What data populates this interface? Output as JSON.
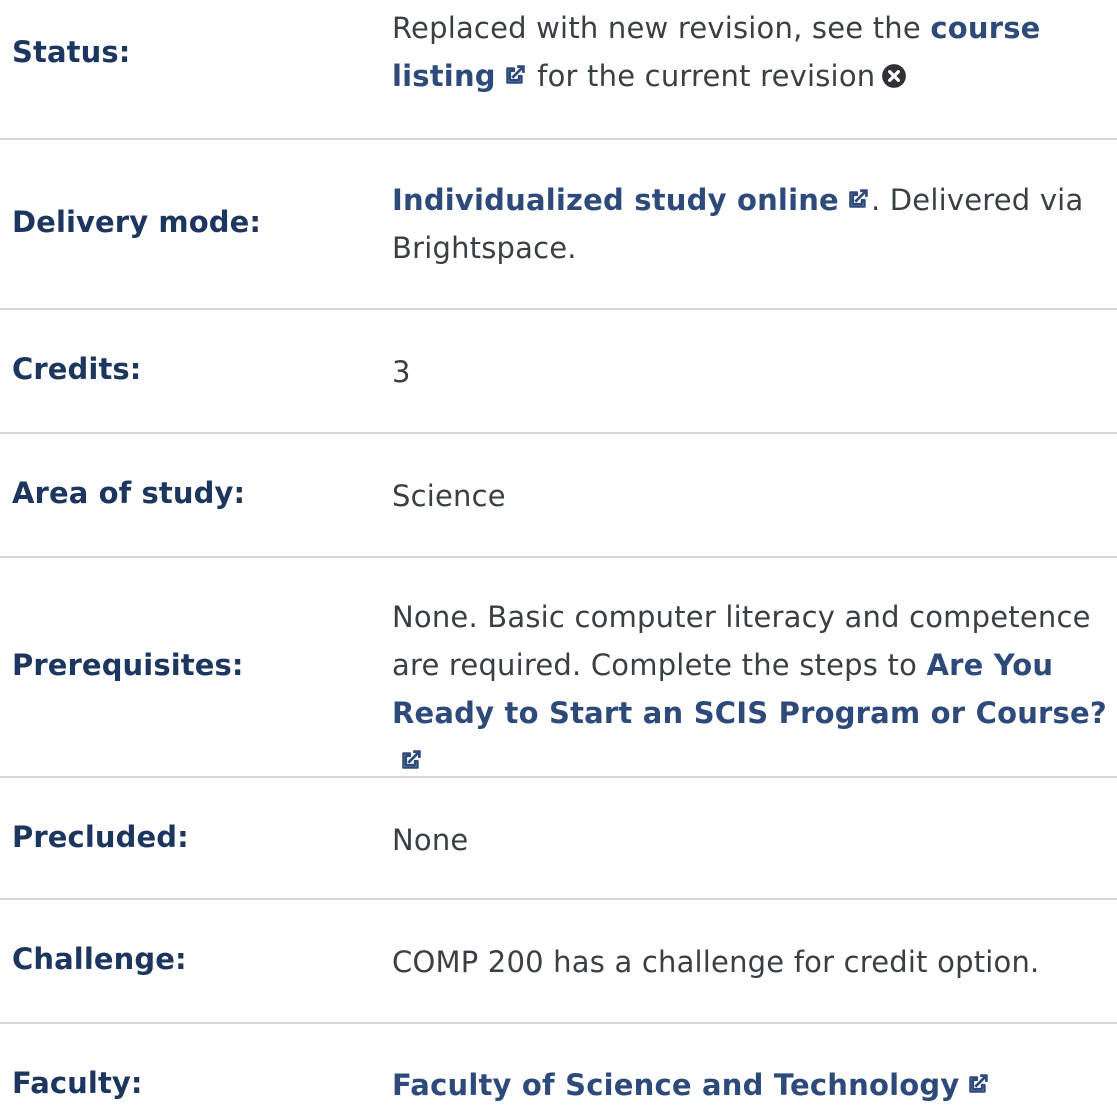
{
  "rows": [
    {
      "label": "Status:",
      "value_prefix": "Replaced with new revision, see the ",
      "link": "course listing",
      "value_suffix": " for the current revision",
      "icon": "times-circle-icon"
    },
    {
      "label": "Delivery mode:",
      "link": "Individualized study online",
      "value_suffix": ". Delivered via Brightspace."
    },
    {
      "label": "Credits:",
      "value": "3"
    },
    {
      "label": "Area of study:",
      "value": "Science"
    },
    {
      "label": "Prerequisites:",
      "value_prefix": "None. Basic computer literacy and competence are required. Complete the steps to ",
      "link": "Are You Ready to Start an SCIS Program or Course?"
    },
    {
      "label": "Precluded:",
      "value": "None"
    },
    {
      "label": "Challenge:",
      "value": "COMP 200 has a challenge for credit option."
    },
    {
      "label": "Faculty:",
      "link": "Faculty of Science and Technology"
    }
  ],
  "colors": {
    "label": "#1c3660",
    "link": "#2d4a7a",
    "text": "#3a3f45",
    "divider": "#d6d6d6"
  },
  "icons": {
    "external_link": "external-link-icon",
    "status": "times-circle-icon"
  }
}
